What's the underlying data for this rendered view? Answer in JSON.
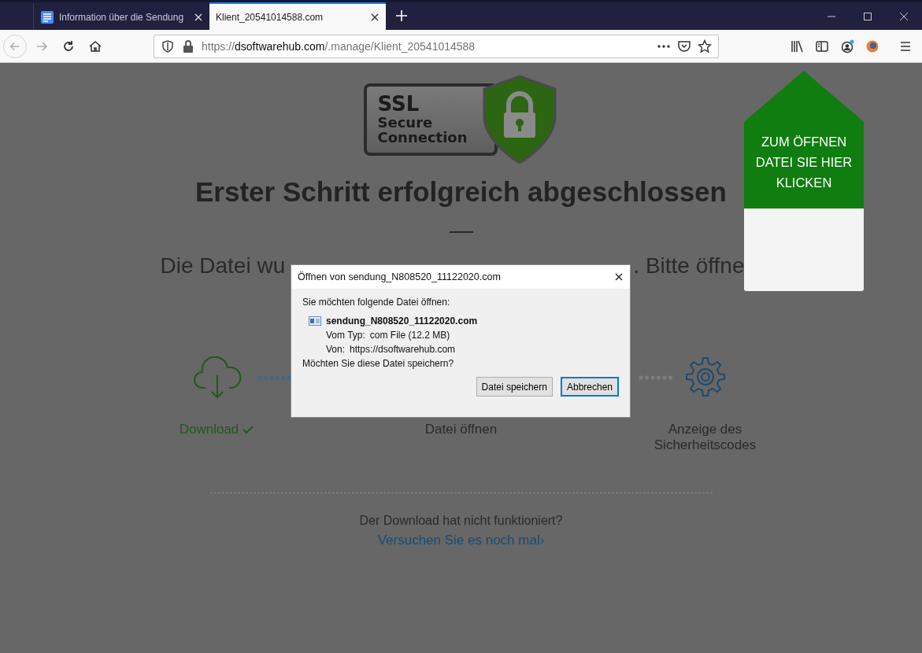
{
  "browser": {
    "tabs": [
      {
        "title": "Information über die Sendung",
        "selected": false
      },
      {
        "title": "Klient_20541014588.com",
        "selected": true
      }
    ],
    "url": {
      "scheme": "https://",
      "host": "dsoftwarehub.com",
      "path": "/.manage/Klient_20541014588"
    }
  },
  "page": {
    "badge": {
      "lines": [
        "SSL",
        "Secure",
        "Connection"
      ]
    },
    "heading": "Erster Schritt erfolgreich abgeschlossen",
    "subtitle_left": "Die Datei wu",
    "subtitle_right": ". Bitte öffne",
    "steps": [
      {
        "label": "Download",
        "done": true,
        "kind": "download"
      },
      {
        "label": "Datei öffnen",
        "done": false,
        "kind": "open"
      },
      {
        "label": "Anzeige des Sicherheitscodes",
        "done": false,
        "kind": "code"
      }
    ],
    "retry": {
      "question": "Der Download hat nicht funktioniert?",
      "link": "Versuchen Sie es noch mal",
      "arrow": "›"
    },
    "side_panel": {
      "text": "ZUM ÖFFNEN DATEI SIE HIER KLICKEN"
    }
  },
  "dialog": {
    "title": "Öffnen von sendung_N808520_11122020.com",
    "prompt": "Sie möchten folgende Datei öffnen:",
    "file_name": "sendung_N808520_11122020.com",
    "details": [
      {
        "label": "Vom Typ:",
        "value": "com File (12.2 MB)"
      },
      {
        "label": "Von:",
        "value": "https://dsoftwarehub.com"
      }
    ],
    "question": "Möchten Sie diese Datei speichern?",
    "buttons": [
      {
        "label": "Datei speichern",
        "default": false
      },
      {
        "label": "Abbrechen",
        "default": true
      }
    ]
  }
}
